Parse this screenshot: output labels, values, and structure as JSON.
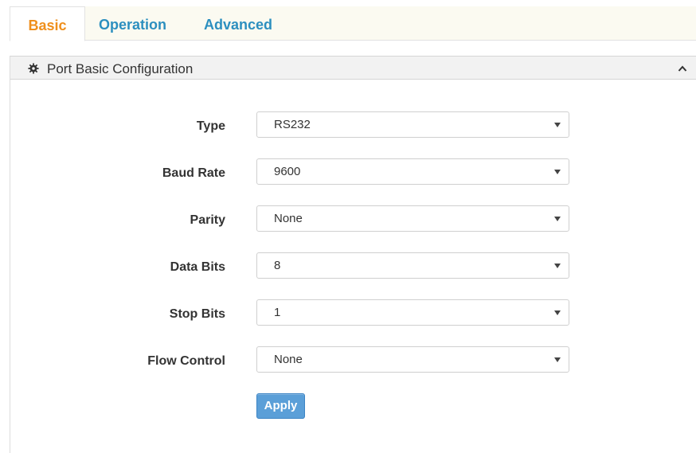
{
  "tabs": [
    {
      "label": "Basic",
      "active": true
    },
    {
      "label": "Operation",
      "active": false
    },
    {
      "label": "Advanced",
      "active": false
    }
  ],
  "panel": {
    "title": "Port Basic Configuration",
    "icon": "gear-icon",
    "collapse_icon": "chevron-up-icon"
  },
  "form": {
    "type": {
      "label": "Type",
      "value": "RS232"
    },
    "baud_rate": {
      "label": "Baud Rate",
      "value": "9600"
    },
    "parity": {
      "label": "Parity",
      "value": "None"
    },
    "data_bits": {
      "label": "Data Bits",
      "value": "8"
    },
    "stop_bits": {
      "label": "Stop Bits",
      "value": "1"
    },
    "flow_control": {
      "label": "Flow Control",
      "value": "None"
    }
  },
  "apply_label": "Apply",
  "colors": {
    "active_tab": "#ef8f1c",
    "inactive_tab": "#2c8fbf",
    "apply_button": "#5b9fd8"
  }
}
